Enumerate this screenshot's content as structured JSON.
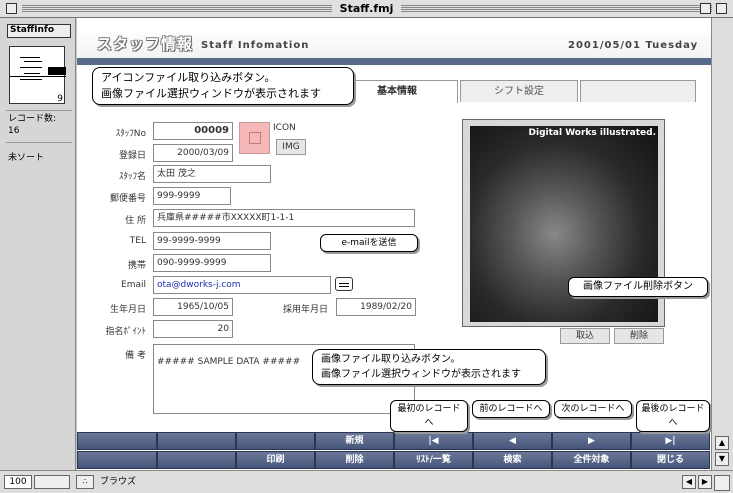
{
  "window": {
    "title": "Staff.fmj"
  },
  "sidebar": {
    "layout": "StaffInfo",
    "page_number": "9",
    "records_label": "レコード数:",
    "records_count": "16",
    "sort_state": "未ソート"
  },
  "header": {
    "title": "スタッフ情報",
    "subtitle": "Staff Infomation",
    "date": "2001/05/01 Tuesday"
  },
  "tabs": [
    {
      "label": "基本情報",
      "active": true
    },
    {
      "label": "シフト設定",
      "active": false
    },
    {
      "label": "",
      "active": false
    }
  ],
  "fields": {
    "staff_no": {
      "label": "ｽﾀｯﾌNo",
      "value": "00009"
    },
    "registered": {
      "label": "登録日",
      "value": "2000/03/09"
    },
    "name": {
      "label": "ｽﾀｯﾌ名",
      "value": "太田 茂之"
    },
    "zip": {
      "label": "郵便番号",
      "value": "999-9999"
    },
    "address": {
      "label": "住 所",
      "value": "兵庫県#####市XXXXX町1-1-1"
    },
    "tel": {
      "label": "TEL",
      "value": "99-9999-9999"
    },
    "mobile": {
      "label": "携帯",
      "value": "090-9999-9999"
    },
    "email": {
      "label": "Email",
      "value": "ota@dworks-j.com"
    },
    "birthday": {
      "label": "生年月日",
      "value": "1965/10/05"
    },
    "hired": {
      "label": "採用年月日",
      "value": "1989/02/20"
    },
    "points": {
      "label": "指名ﾎﾟｲﾝﾄ",
      "value": "20"
    },
    "notes": {
      "label": "備 考",
      "value": "##### SAMPLE DATA #####"
    }
  },
  "icon_area": {
    "label": "ICON",
    "img_button": "IMG"
  },
  "photo": {
    "caption": "Digital Works illustrated."
  },
  "photo_buttons": {
    "import": "取込",
    "delete": "削除"
  },
  "bottom_bar": {
    "row1": [
      "",
      "",
      "",
      "新規",
      "|◀",
      "◀",
      "▶",
      "▶|"
    ],
    "row2": [
      "",
      "",
      "印刷",
      "削除",
      "ﾘｽﾄ/一覧",
      "検索",
      "全件対象",
      "閉じる"
    ]
  },
  "callouts": {
    "icon_import_1": "アイコンファイル取り込みボタン。",
    "icon_import_2": "画像ファイル選択ウィンドウが表示されます",
    "email_send": "e-mailを送信",
    "photo_delete": "画像ファイル削除ボタン",
    "photo_import_1": "画像ファイル取り込みボタン。",
    "photo_import_2": "画像ファイル選択ウィンドウが表示されます",
    "first_record": "最初のレコードへ",
    "prev_record": "前のレコードへ",
    "next_record": "次のレコードへ",
    "last_record": "最後のレコードへ"
  },
  "statusbar": {
    "zoom": "100",
    "mode": "ブラウズ"
  }
}
